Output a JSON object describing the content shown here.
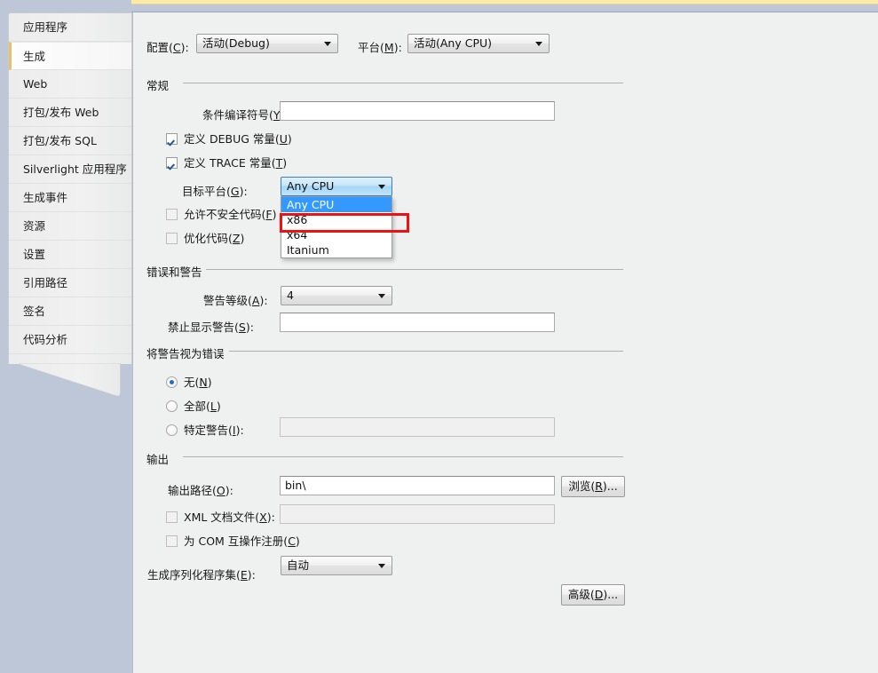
{
  "window": {
    "accent_yellow": "#fdeaa8",
    "accent_blue_band": "#bdc7d8",
    "selected_tab_accent": "#e8c06a",
    "highlight_blue": "#3399ff",
    "annotation_red": "#ee1111"
  },
  "sidebar": {
    "items": [
      {
        "label": "应用程序",
        "selected": false
      },
      {
        "label": "生成",
        "selected": true
      },
      {
        "label": "Web",
        "selected": false
      },
      {
        "label": "打包/发布 Web",
        "selected": false
      },
      {
        "label": "打包/发布 SQL",
        "selected": false
      },
      {
        "label": "Silverlight 应用程序",
        "selected": false
      },
      {
        "label": "生成事件",
        "selected": false
      },
      {
        "label": "资源",
        "selected": false
      },
      {
        "label": "设置",
        "selected": false
      },
      {
        "label": "引用路径",
        "selected": false
      },
      {
        "label": "签名",
        "selected": false
      },
      {
        "label": "代码分析",
        "selected": false
      }
    ]
  },
  "config_row": {
    "configuration_label": "配置(",
    "configuration_mnemonic": "C",
    "configuration_label_tail": "):",
    "configuration_value": "活动(Debug)",
    "platform_label": "平台(",
    "platform_mnemonic": "M",
    "platform_label_tail": "):",
    "platform_value": "活动(Any CPU)"
  },
  "general": {
    "heading": "常规",
    "conditional_symbols_label": "条件编译符号(",
    "conditional_symbols_mnemonic": "Y",
    "conditional_symbols_label_tail": "):",
    "conditional_symbols_value": "",
    "define_debug_label": "定义 DEBUG 常量(",
    "define_debug_mnemonic": "U",
    "define_debug_label_tail": ")",
    "define_debug_checked": true,
    "define_trace_label": "定义 TRACE 常量(",
    "define_trace_mnemonic": "T",
    "define_trace_label_tail": ")",
    "define_trace_checked": true,
    "target_platform_label": "目标平台(",
    "target_platform_mnemonic": "G",
    "target_platform_label_tail": "):",
    "target_platform_value": "Any CPU",
    "target_platform_options": [
      "Any CPU",
      "x86",
      "x64",
      "Itanium"
    ],
    "target_platform_selected_index": 0,
    "target_platform_annotated_index": 1,
    "allow_unsafe_label": "允许不安全代码(",
    "allow_unsafe_mnemonic": "F",
    "allow_unsafe_label_tail": ")",
    "allow_unsafe_checked": false,
    "optimize_label": "优化代码(",
    "optimize_mnemonic": "Z",
    "optimize_label_tail": ")",
    "optimize_checked": false
  },
  "errors_warnings": {
    "heading": "错误和警告",
    "warning_level_label": "警告等级(",
    "warning_level_mnemonic": "A",
    "warning_level_label_tail": "):",
    "warning_level_value": "4",
    "suppress_warnings_label": "禁止显示警告(",
    "suppress_warnings_mnemonic": "S",
    "suppress_warnings_label_tail": "):",
    "suppress_warnings_value": ""
  },
  "treat_warnings": {
    "heading": "将警告视为错误",
    "none_label": "无(",
    "none_mnemonic": "N",
    "none_label_tail": ")",
    "all_label": "全部(",
    "all_mnemonic": "L",
    "all_label_tail": ")",
    "specific_label": "特定警告(",
    "specific_mnemonic": "I",
    "specific_label_tail": "):",
    "specific_value": "",
    "selected": "none"
  },
  "output": {
    "heading": "输出",
    "output_path_label": "输出路径(",
    "output_path_mnemonic": "O",
    "output_path_label_tail": "):",
    "output_path_value": "bin\\",
    "browse_button": "浏览(",
    "browse_button_mnemonic": "R",
    "browse_button_tail": ")...",
    "xml_doc_label": "XML 文档文件(",
    "xml_doc_mnemonic": "X",
    "xml_doc_label_tail": "):",
    "xml_doc_checked": false,
    "xml_doc_value": "",
    "com_interop_label": "为 COM 互操作注册(",
    "com_interop_mnemonic": "C",
    "com_interop_label_tail": ")",
    "com_interop_checked": false,
    "serialization_label": "生成序列化程序集(",
    "serialization_mnemonic": "E",
    "serialization_label_tail": "):",
    "serialization_value": "自动",
    "advanced_button": "高级(",
    "advanced_button_mnemonic": "D",
    "advanced_button_tail": ")..."
  }
}
